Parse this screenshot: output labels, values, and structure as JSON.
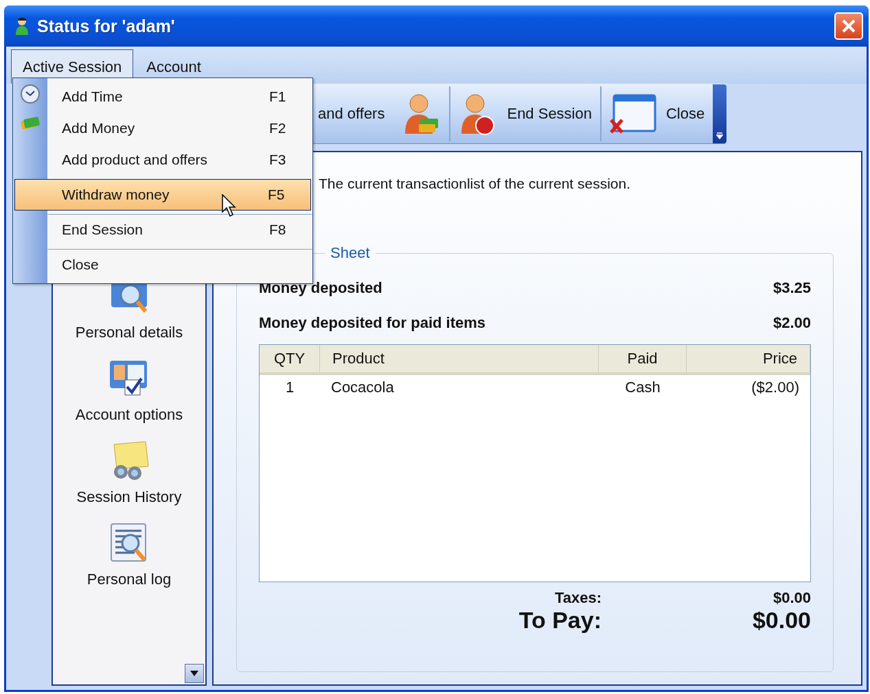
{
  "window": {
    "title": "Status for 'adam'"
  },
  "menu_bar": [
    {
      "label": "Active Session",
      "selected": true
    },
    {
      "label": "Account",
      "selected": false
    }
  ],
  "dropdown": {
    "items": [
      {
        "label": "Add Time",
        "shortcut": "F1",
        "selected": false,
        "separator_before": false
      },
      {
        "label": "Add Money",
        "shortcut": "F2",
        "selected": false,
        "separator_before": false
      },
      {
        "label": "Add product and offers",
        "shortcut": "F3",
        "selected": false,
        "separator_before": false
      },
      {
        "label": "Withdraw money",
        "shortcut": "F5",
        "selected": true,
        "separator_before": true
      },
      {
        "label": "End Session",
        "shortcut": "F8",
        "selected": false,
        "separator_before": true
      },
      {
        "label": "Close",
        "selected": false,
        "separator_before": true
      }
    ]
  },
  "toolbar": {
    "buttons": [
      {
        "label": "and offers"
      },
      {
        "separator_before": false
      },
      {
        "label": "End Session",
        "separator_before": true
      },
      {
        "label": "Close",
        "separator_before": true
      }
    ]
  },
  "sidebar": {
    "items": [
      {
        "label": "Personal details"
      },
      {
        "label": "Account options"
      },
      {
        "label": "Session History"
      },
      {
        "label": "Personal log"
      }
    ]
  },
  "panel": {
    "description": "The current transactionlist of the current session.",
    "group_title": "Sheet",
    "summary": [
      {
        "label": "Money deposited",
        "value": "$3.25"
      },
      {
        "label": "Money deposited for paid items",
        "value": "$2.00"
      }
    ],
    "table": {
      "columns": [
        "QTY",
        "Product",
        "Paid",
        "Price"
      ],
      "rows": [
        [
          "1",
          "Cocacola",
          "Cash",
          "($2.00)"
        ]
      ]
    },
    "taxes": {
      "label": "Taxes:",
      "value": "$0.00"
    },
    "to_pay": {
      "label": "To Pay:",
      "value": "$0.00"
    }
  }
}
